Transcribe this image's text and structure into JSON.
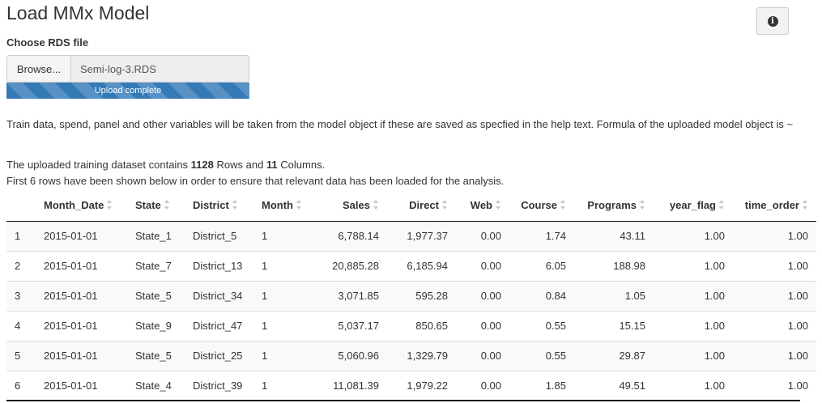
{
  "header": {
    "title": "Load MMx Model",
    "info_icon": "info-circle-icon"
  },
  "file_input": {
    "label": "Choose RDS file",
    "browse_label": "Browse...",
    "file_name": "Semi-log-3.RDS",
    "progress_text": "Upload complete",
    "progress": 1.0
  },
  "notes": {
    "line1": "Train data, spend, panel and other variables will be taken from the model object if these are saved as specfied in the help text. Formula of the uploaded model object is ~",
    "line2_pre": "The uploaded training dataset contains ",
    "rows": "1128",
    "line2_mid": " Rows and ",
    "cols": "11",
    "line2_post": " Columns.",
    "line3": "First 6 rows have been shown below in order to ensure that relevant data has been loaded for the analysis."
  },
  "table": {
    "columns": [
      "",
      "Month_Date",
      "State",
      "District",
      "Month",
      "Sales",
      "Direct",
      "Web",
      "Course",
      "Programs",
      "year_flag",
      "time_order"
    ],
    "rows": [
      [
        "1",
        "2015-01-01",
        "State_1",
        "District_5",
        "1",
        "6,788.14",
        "1,977.37",
        "0.00",
        "1.74",
        "43.11",
        "1.00",
        "1.00"
      ],
      [
        "2",
        "2015-01-01",
        "State_7",
        "District_13",
        "1",
        "20,885.28",
        "6,185.94",
        "0.00",
        "6.05",
        "188.98",
        "1.00",
        "1.00"
      ],
      [
        "3",
        "2015-01-01",
        "State_5",
        "District_34",
        "1",
        "3,071.85",
        "595.28",
        "0.00",
        "0.84",
        "1.05",
        "1.00",
        "1.00"
      ],
      [
        "4",
        "2015-01-01",
        "State_9",
        "District_47",
        "1",
        "5,037.17",
        "850.65",
        "0.00",
        "0.55",
        "15.15",
        "1.00",
        "1.00"
      ],
      [
        "5",
        "2015-01-01",
        "State_5",
        "District_25",
        "1",
        "5,060.96",
        "1,329.79",
        "0.00",
        "0.55",
        "29.87",
        "1.00",
        "1.00"
      ],
      [
        "6",
        "2015-01-01",
        "State_4",
        "District_39",
        "1",
        "11,081.39",
        "1,979.22",
        "0.00",
        "1.85",
        "49.51",
        "1.00",
        "1.00"
      ]
    ]
  }
}
